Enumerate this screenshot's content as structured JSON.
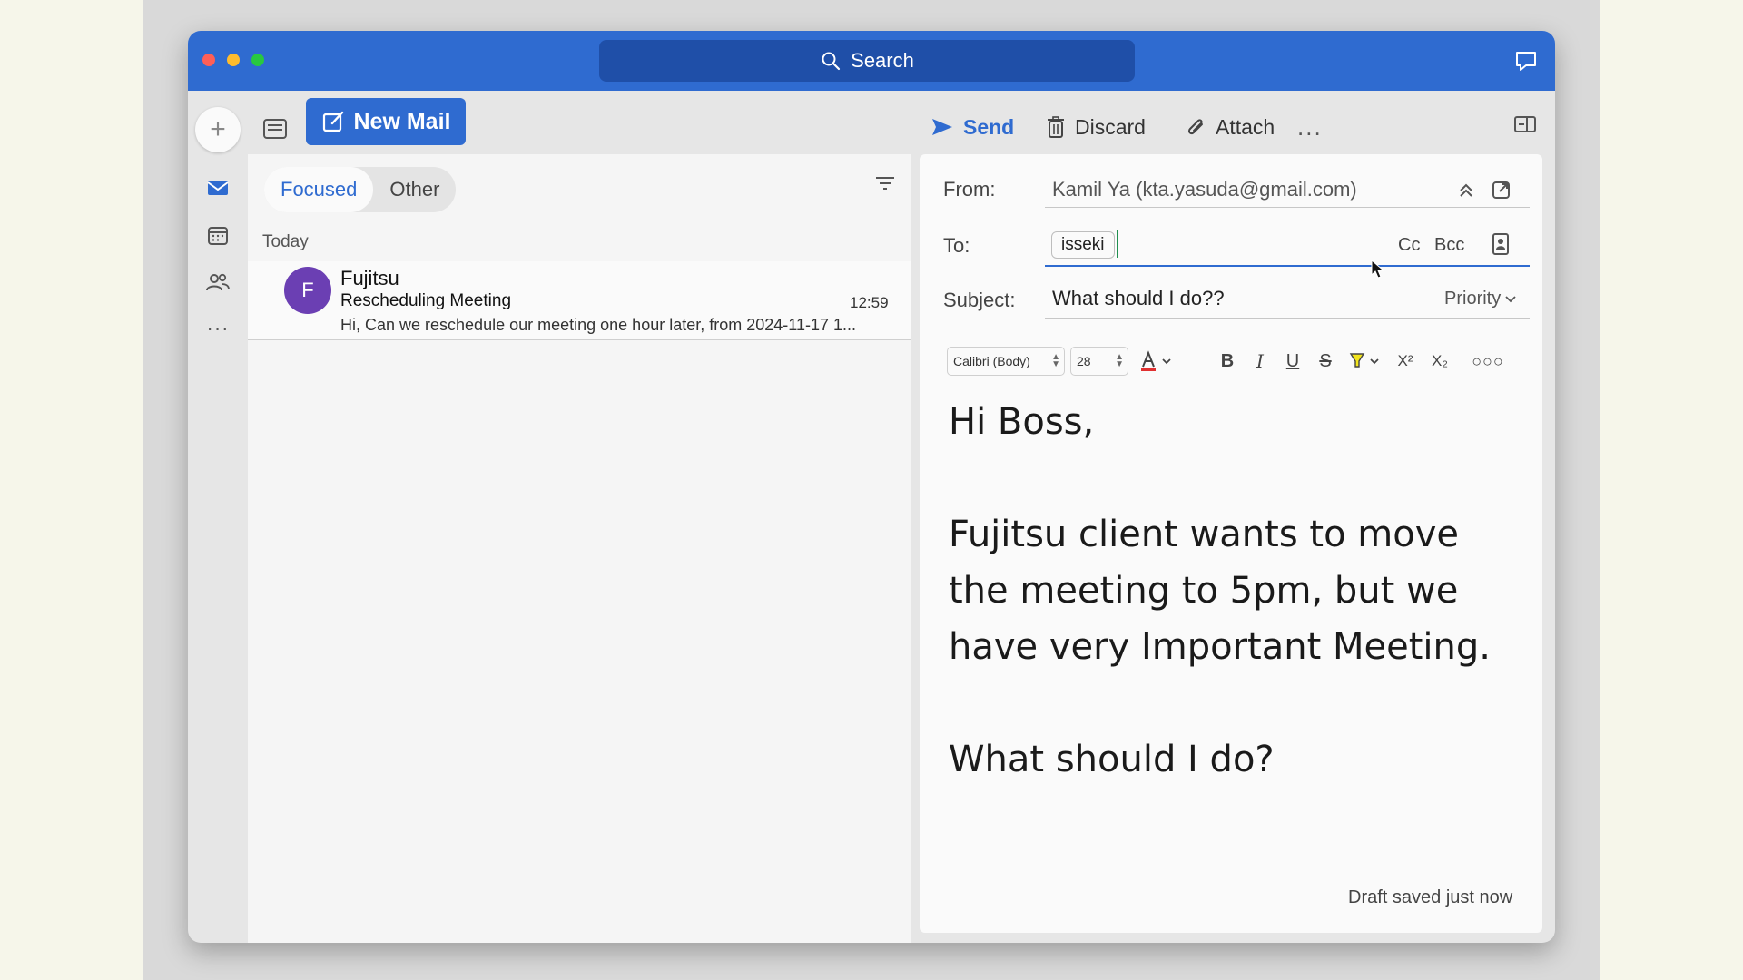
{
  "search": {
    "label": "Search"
  },
  "toolbar": {
    "new_mail_label": "New Mail",
    "send_label": "Send",
    "discard_label": "Discard",
    "attach_label": "Attach",
    "more_label": "..."
  },
  "list": {
    "tabs": [
      {
        "label": "Focused",
        "active": true
      },
      {
        "label": "Other",
        "active": false
      }
    ],
    "group_label": "Today",
    "messages": [
      {
        "avatar_letter": "F",
        "sender": "Fujitsu",
        "subject": "Rescheduling Meeting",
        "time": "12:59",
        "preview": "Hi, Can we reschedule our meeting one hour later, from 2024-11-17 1..."
      }
    ]
  },
  "compose": {
    "from_label": "From:",
    "from_value": "Kamil Ya (kta.yasuda@gmail.com)",
    "to_label": "To:",
    "to_recipient": "isseki",
    "cc_label": "Cc",
    "bcc_label": "Bcc",
    "subject_label": "Subject:",
    "subject_value": "What should I do??",
    "priority_label": "Priority",
    "font_name": "Calibri (Body)",
    "font_size": "28",
    "body": {
      "line1": "Hi Boss,",
      "line2": "Fujitsu client wants to move the meeting to 5pm, but we have very Important Meeting.",
      "line3": "What should I do?"
    },
    "draft_status": "Draft saved just now"
  },
  "colors": {
    "accent": "#2f6bd0",
    "avatar": "#6b3fb3",
    "text_color_indicator": "#e03030",
    "highlight_indicator": "#f2e41c"
  }
}
